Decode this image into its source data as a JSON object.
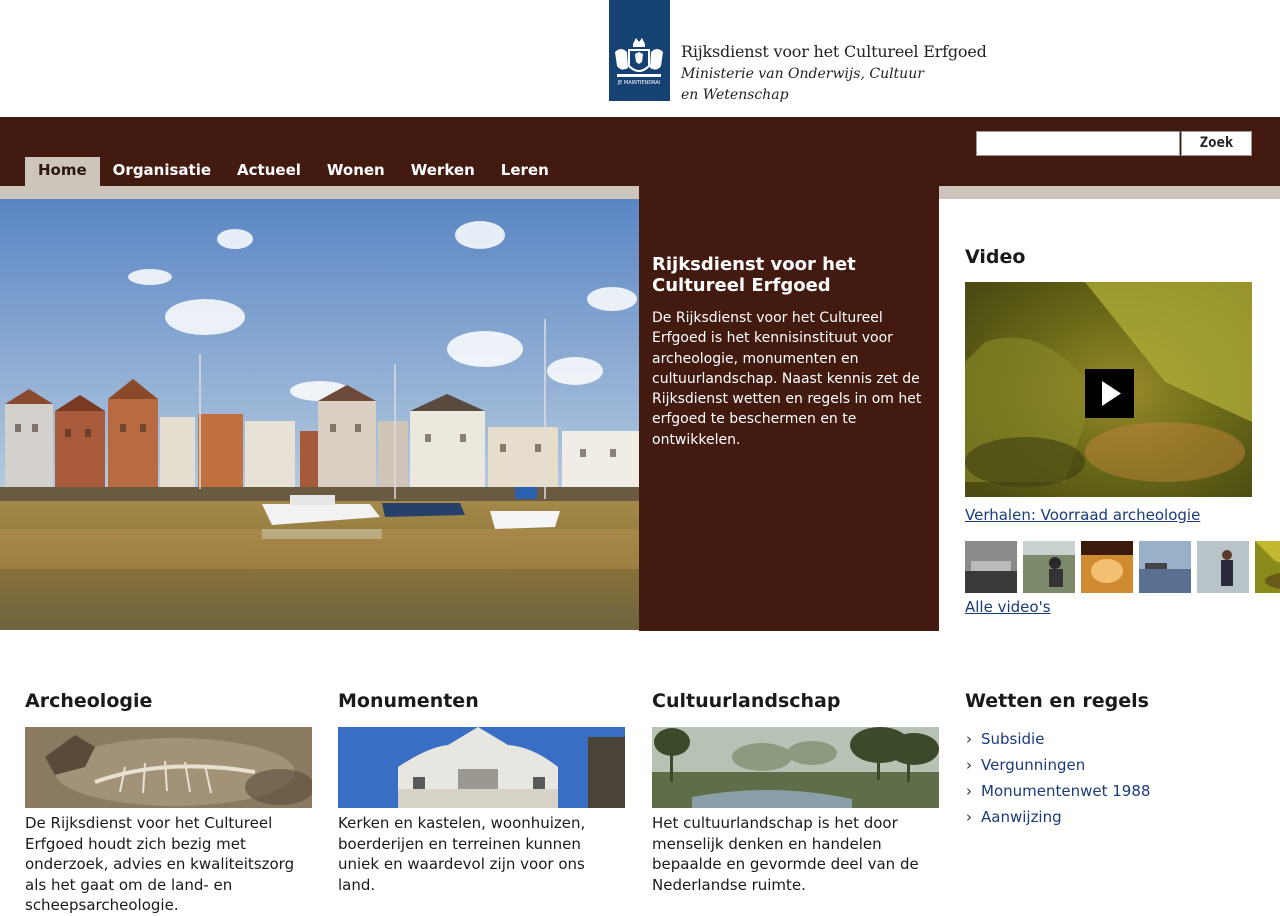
{
  "header": {
    "org_name": "Rijksdienst voor het Cultureel Erfgoed",
    "ministry": "Ministerie van Onderwijs, Cultuur en Wetenschap",
    "brand_color": "#154273"
  },
  "nav": {
    "items": [
      {
        "label": "Home",
        "active": true
      },
      {
        "label": "Organisatie"
      },
      {
        "label": "Actueel"
      },
      {
        "label": "Wonen"
      },
      {
        "label": "Werken"
      },
      {
        "label": "Leren"
      }
    ],
    "band_color": "#421a0f"
  },
  "search": {
    "value": "",
    "button_label": "Zoek"
  },
  "hero": {
    "title": "Rijksdienst voor het Cultureel Erfgoed",
    "text": "De Rijksdienst voor het Cultureel Erfgoed is het kennisinstituut voor archeologie, monumenten en cultuurlandschap. Naast kennis zet de Rijksdienst wetten en regels in om het erfgoed te beschermen en te ontwikkelen."
  },
  "video": {
    "heading": "Video",
    "link": "Verhalen: Voorraad archeologie",
    "all_link": "Alle video's"
  },
  "columns": [
    {
      "heading": "Archeologie",
      "text": "De Rijksdienst voor het Cultureel Erfgoed houdt zich bezig met onderzoek, advies en kwaliteitszorg als het gaat om de land- en scheepsarcheologie."
    },
    {
      "heading": "Monumenten",
      "text": "Kerken en kastelen, woonhuizen, boerderijen en terreinen kunnen uniek en waardevol zijn voor ons land."
    },
    {
      "heading": "Cultuurlandschap",
      "text": "Het cultuurlandschap is het door menselijk denken en handelen bepaalde en gevormde deel van de Nederlandse ruimte."
    }
  ],
  "rules": {
    "heading": "Wetten en regels",
    "items": [
      "Subsidie",
      "Vergunningen",
      "Monumentenwet 1988",
      "Aanwijzing"
    ]
  }
}
